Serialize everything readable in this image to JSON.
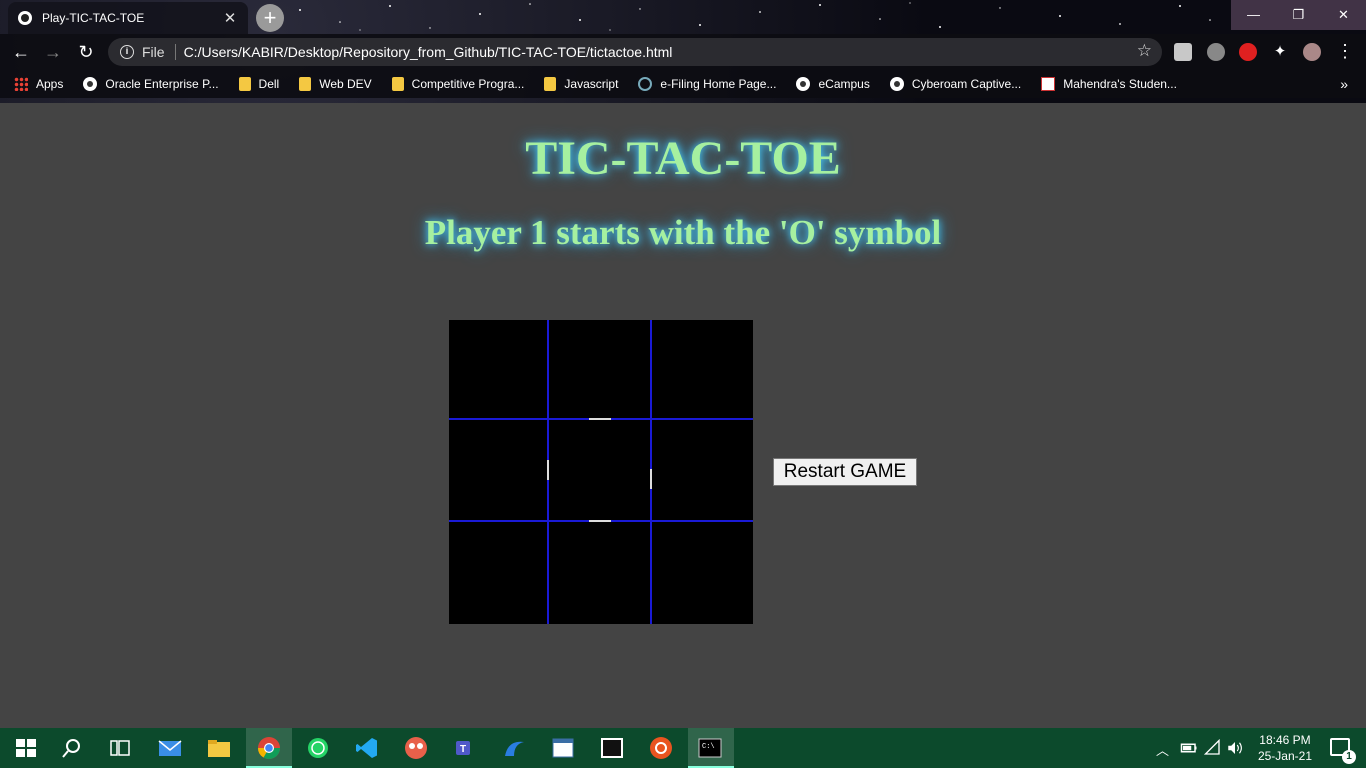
{
  "browser": {
    "tab_title": "Play-TIC-TAC-TOE",
    "tab_close": "✕",
    "new_tab": "+",
    "scheme": "File",
    "url": "C:/Users/KABIR/Desktop/Repository_from_Github/TIC-TAC-TOE/tictactoe.html",
    "window_controls": {
      "minimize": "—",
      "maximize": "❐",
      "close": "✕"
    },
    "bookmarks": [
      {
        "label": "Apps",
        "icon": "apps-icon"
      },
      {
        "label": "Oracle Enterprise P...",
        "icon": "globe-icon"
      },
      {
        "label": "Dell",
        "icon": "folder-icon"
      },
      {
        "label": "Web DEV",
        "icon": "folder-icon"
      },
      {
        "label": "Competitive Progra...",
        "icon": "folder-icon"
      },
      {
        "label": "Javascript",
        "icon": "folder-icon"
      },
      {
        "label": "e-Filing Home Page...",
        "icon": "efiling-icon"
      },
      {
        "label": "eCampus",
        "icon": "globe-icon"
      },
      {
        "label": "Cyberoam Captive...",
        "icon": "globe-icon"
      },
      {
        "label": "Mahendra's Studen...",
        "icon": "site-icon"
      }
    ],
    "bookmarks_more": "»"
  },
  "page": {
    "title": "TIC-TAC-TOE",
    "subtitle": "Player 1 starts with the 'O' symbol",
    "restart_label": "Restart GAME"
  },
  "board": {
    "cells": [
      "",
      "",
      "",
      "",
      "",
      "",
      "",
      "",
      ""
    ]
  },
  "taskbar": {
    "clock_time": "18:46 PM",
    "clock_date": "25-Jan-21",
    "notification_count": "1"
  },
  "colors": {
    "page_bg": "#444444",
    "title_text": "#a6f0a0",
    "title_glow": "#4ad0ff",
    "board_bg": "#000000",
    "grid_lines": "#1a1ad6",
    "taskbar_bg": "#0c4a2c"
  }
}
